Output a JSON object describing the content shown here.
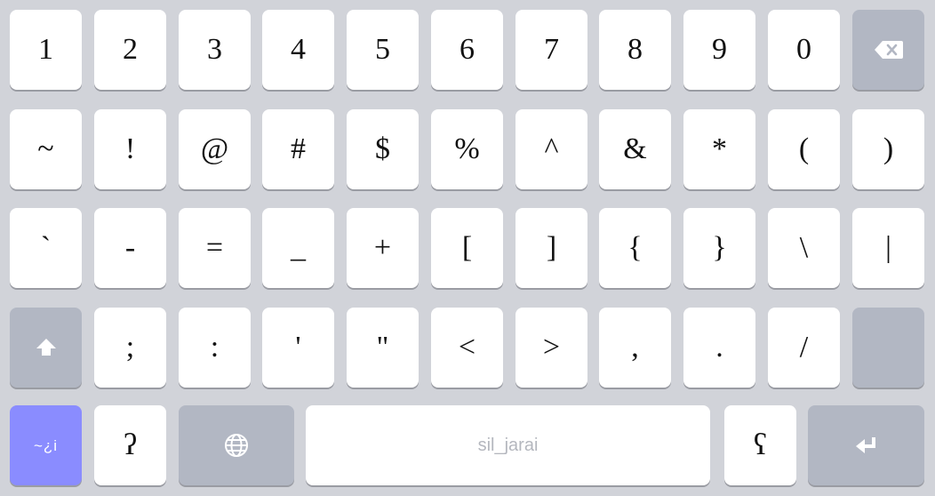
{
  "keyboard": {
    "rows": [
      [
        "1",
        "2",
        "3",
        "4",
        "5",
        "6",
        "7",
        "8",
        "9",
        "0"
      ],
      [
        "~",
        "!",
        "@",
        "#",
        "$",
        "%",
        "^",
        "&",
        "*",
        "(",
        ")"
      ],
      [
        "`",
        "-",
        "=",
        "_",
        "+",
        "[",
        "]",
        "{",
        "}",
        "\\",
        "|"
      ],
      [
        ";",
        ":",
        "'",
        "\"",
        "<",
        ">",
        ",",
        ".",
        "/"
      ]
    ],
    "bottom": {
      "symbols_label": "~¿i",
      "question_label": "ʔ",
      "space_label": "sil_jarai",
      "r_label": "ʕ"
    },
    "icons": {
      "backspace": "backspace-icon",
      "shift": "shift-arrow-icon",
      "globe": "globe-icon",
      "enter": "enter-return-icon"
    },
    "colors": {
      "background": "#d1d3d9",
      "key": "#ffffff",
      "function_key": "#b2b7c3",
      "accent_key": "#8a8cff"
    }
  }
}
